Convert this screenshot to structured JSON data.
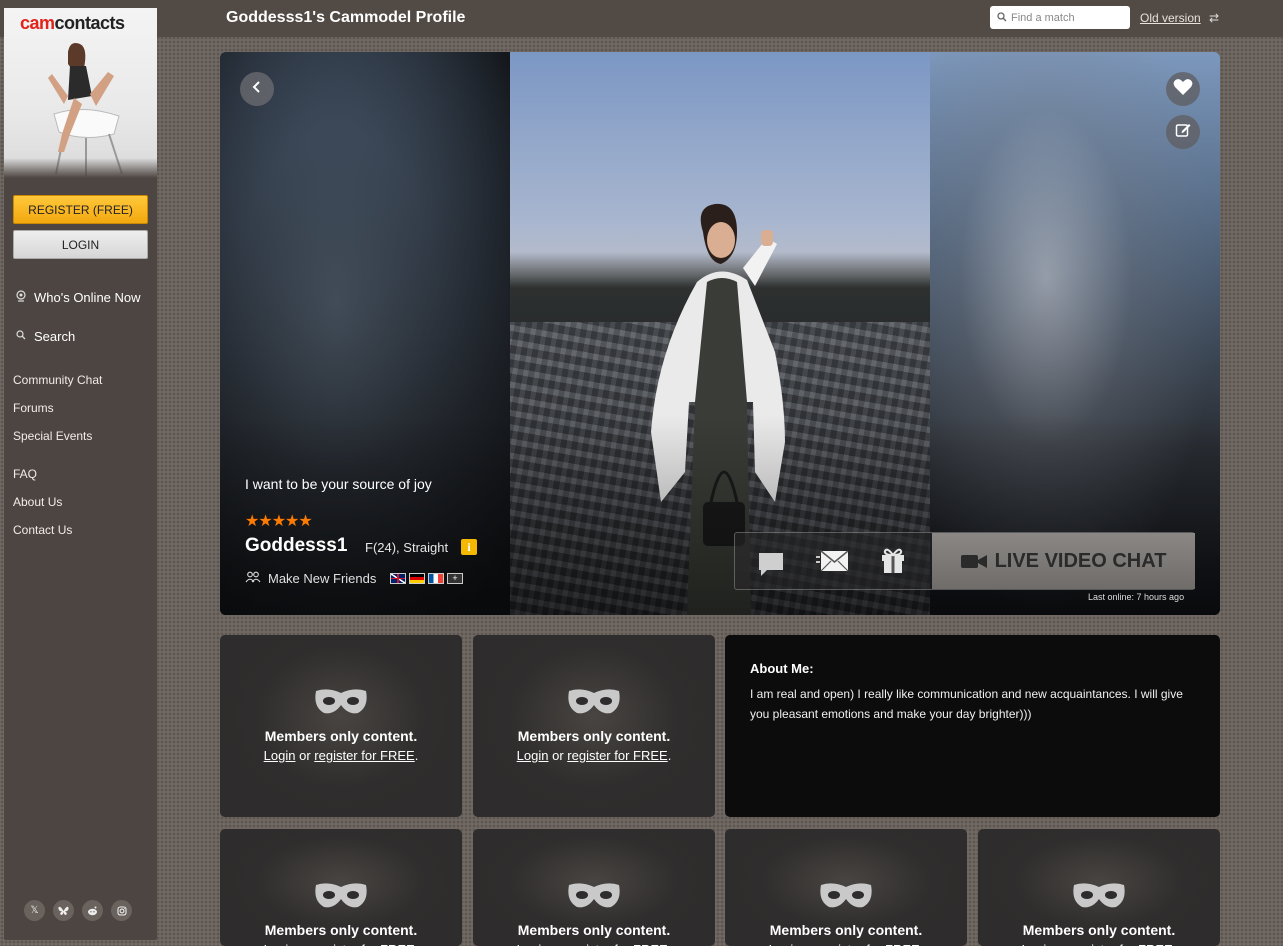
{
  "header": {
    "title": "Goddesss1's Cammodel Profile",
    "search_placeholder": "Find a match",
    "old_version": "Old version"
  },
  "sidebar": {
    "logo_cam": "cam",
    "logo_contacts": "contacts",
    "register": "REGISTER (FREE)",
    "login": "LOGIN",
    "main_links": [
      {
        "label": "Who's Online Now",
        "icon": "webcam-icon"
      },
      {
        "label": "Search",
        "icon": "search-icon"
      }
    ],
    "links_group1": [
      "Community Chat",
      "Forums",
      "Special Events"
    ],
    "links_group2": [
      "FAQ",
      "About Us",
      "Contact Us"
    ],
    "socials": [
      "x-icon",
      "bluesky-icon",
      "reddit-icon",
      "instagram-icon"
    ]
  },
  "profile": {
    "tagline": "I want to be your source of joy",
    "rating": 5,
    "stars": "★★★★★",
    "name": "Goddesss1",
    "demographics": "F(24), Straight",
    "info": "i",
    "looking_for": "Make New Friends",
    "languages": [
      "uk-flag",
      "germany-flag",
      "france-flag",
      "more-languages"
    ],
    "live_chat": "LIVE VIDEO CHAT",
    "last_online": "Last online: 7 hours ago"
  },
  "members_card": {
    "title": "Members only content.",
    "login": "Login",
    "or": "or",
    "register": "register for FREE",
    "period": "."
  },
  "about": {
    "title": "About Me:",
    "text": "I am real and open) I really like communication and new acquaintances. I will give you pleasant emotions and make your day brighter)))"
  },
  "colors": {
    "accent_orange": "#ff7a00",
    "register_yellow": "#f3a80f",
    "logo_red": "#e2231a"
  }
}
